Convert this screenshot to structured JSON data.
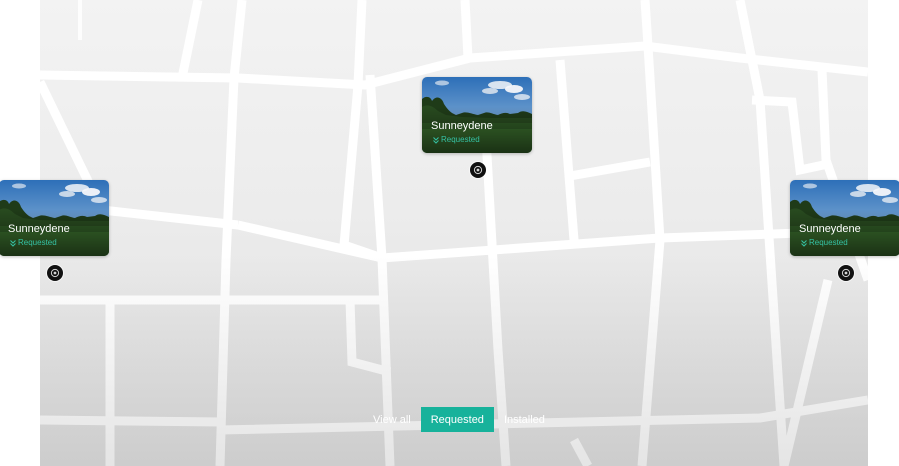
{
  "colors": {
    "accent": "#17b29b",
    "status_text": "#35c2a4",
    "pin": "#111111",
    "map_background": "#ececec",
    "road": "#ffffff"
  },
  "icons": {
    "status": "chevron-double-down-icon",
    "pin": "location-pin-icon"
  },
  "sites": [
    {
      "name": "Sunneydene",
      "status": "Requested"
    },
    {
      "name": "Sunneydene",
      "status": "Requested"
    },
    {
      "name": "Sunneydene",
      "status": "Requested"
    }
  ],
  "filters": {
    "view_all": "View all",
    "requested": "Requested",
    "installed": "Installed",
    "active": "requested"
  }
}
